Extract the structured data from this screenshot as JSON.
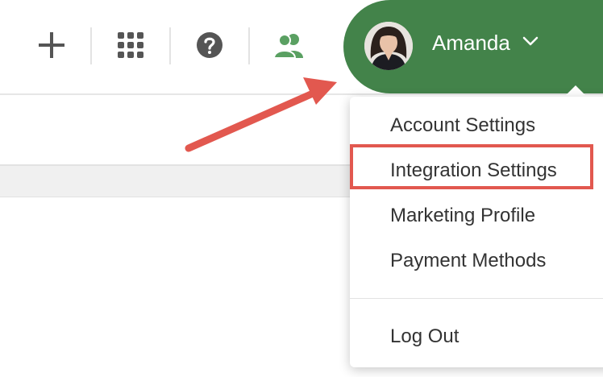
{
  "header": {
    "icons": {
      "add": "plus-icon",
      "apps": "grid-icon",
      "help": "question-icon",
      "team": "users-icon"
    },
    "team_icon_color": "#5aa062",
    "user": {
      "name": "Amanda",
      "pill_color": "#43834a"
    }
  },
  "menu": {
    "items": [
      "Account Settings",
      "Integration Settings",
      "Marketing Profile",
      "Payment Methods"
    ],
    "logout_label": "Log Out",
    "highlighted_item": "Integration Settings",
    "annotation_color": "#e2584f"
  }
}
